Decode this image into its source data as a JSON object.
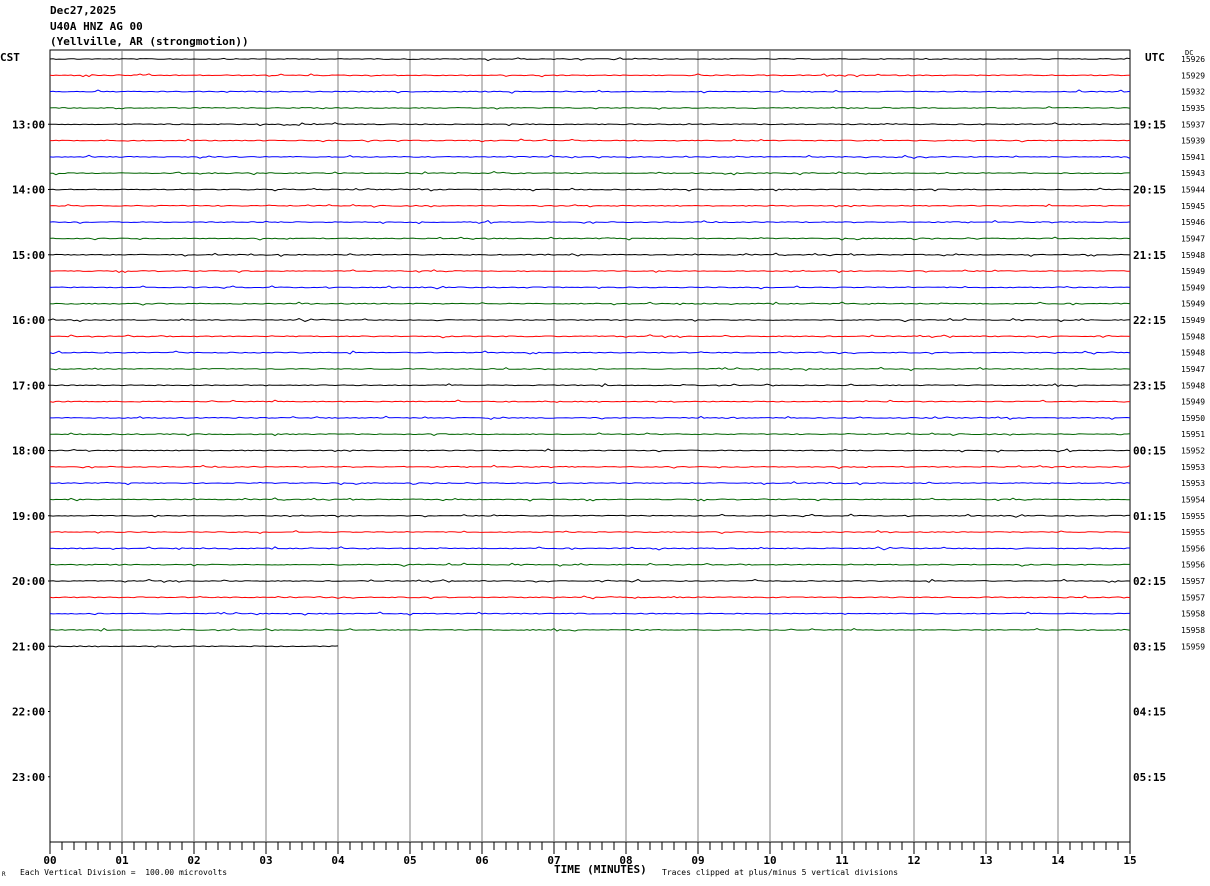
{
  "header": {
    "date": "Dec27,2025",
    "station": "U40A HNZ AG 00",
    "location": "(Yellville, AR (strongmotion))"
  },
  "left_tz": "CST",
  "right_tz": "UTC",
  "dc_label": "DC",
  "footer": {
    "scale": "Each Vertical Division =  100.00 microvolts",
    "clip": "Traces clipped at plus/minus 5 vertical divisions",
    "small_mark": "R"
  },
  "colors": {
    "trace_cycle": [
      "#000000",
      "#ff0000",
      "#0000ff",
      "#006400"
    ],
    "grid": "#808080"
  },
  "chart_data": {
    "type": "line",
    "title": "",
    "xlabel": "TIME (MINUTES)",
    "ylabel": "",
    "x_ticks": [
      "00",
      "01",
      "02",
      "03",
      "04",
      "05",
      "06",
      "07",
      "08",
      "09",
      "10",
      "11",
      "12",
      "13",
      "14",
      "15"
    ],
    "xlim": [
      0,
      15
    ],
    "rows_total": 48,
    "rows_per_hour": 4,
    "left_hour_labels": [
      "13:00",
      "14:00",
      "15:00",
      "16:00",
      "17:00",
      "18:00",
      "19:00",
      "20:00",
      "21:00",
      "22:00",
      "23:00"
    ],
    "right_hour_labels": [
      "19:15",
      "20:15",
      "21:15",
      "22:15",
      "23:15",
      "00:15",
      "01:15",
      "02:15",
      "03:15",
      "04:15",
      "05:15"
    ],
    "dc_offsets": [
      15926,
      15929,
      15932,
      15935,
      15937,
      15939,
      15941,
      15943,
      15944,
      15945,
      15946,
      15947,
      15948,
      15949,
      15949,
      15949,
      15949,
      15948,
      15948,
      15947,
      15948,
      15949,
      15950,
      15951,
      15952,
      15953,
      15953,
      15954,
      15955,
      15955,
      15956,
      15956,
      15957,
      15957,
      15958,
      15958,
      15959
    ],
    "last_row_end_minute": 4.0
  }
}
